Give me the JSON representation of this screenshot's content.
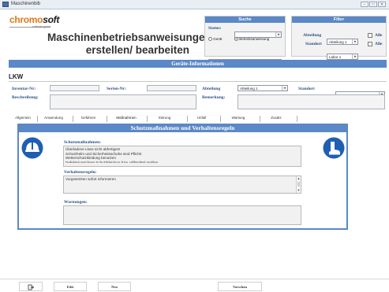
{
  "window": {
    "title": "Maschinenbib",
    "min": "–",
    "max": "□",
    "close": "✕"
  },
  "logo": {
    "part1": "chromo",
    "part2": "soft",
    "tagline": "software gmbh"
  },
  "main_title": {
    "line1": "Maschinenbetriebsanweisungen",
    "line2": "erstellen/ bearbeiten"
  },
  "suche": {
    "header": "Suche",
    "status_label": "Status:",
    "status_value": "",
    "radio_geraet": "Gerät",
    "radio_betrieb": "Betriebsanweisung",
    "selected_radio": "Betriebsanweisung",
    "search_value": ""
  },
  "filter": {
    "header": "Filter",
    "abteilung_label": "Abteilung",
    "abteilung_value": "Abteilung 1",
    "standort_label": "Standort",
    "standort_value": "Labor 1",
    "alle1": "Alle",
    "alle2": "Alle"
  },
  "geraete": {
    "header": "Geräte-Informationen",
    "device_name": "LKW",
    "inventar_label": "Inventar-Nr:",
    "inventar_value": "",
    "serien_label": "Serien-Nr:",
    "serien_value": "",
    "abteilung_label": "Abteilung",
    "abteilung_value": "Abteilung 1",
    "standort_label": "Standort",
    "standort_value": "",
    "beschreibung_label": "Beschreibung:",
    "beschreibung_value": "",
    "bemerkung_label": "Bemerkung:",
    "bemerkung_value": ""
  },
  "tabs": [
    "Allgemein",
    "Anwendung",
    "Gefahren",
    "Maßnahmen",
    "Störung",
    "Unfall",
    "Wartung",
    "Zusätz"
  ],
  "active_tab": "Maßnahmen",
  "section": {
    "title": "Schutzmaßnahmen und Verhaltensregeln",
    "schutz_label": "Schutzmaßnahmen:",
    "schutz_lines": [
      "Überladene Lkws nicht abfertigen!",
      "Schutzhelm und Sicherheitsschuhe sind Pflicht!",
      "Wetterschutzkleidung benutzen",
      "Defekte/unsichere Schutzkleidung bzw. Hilfsmittel melden"
    ],
    "verhalten_label": "Verhaltensregeln:",
    "verhalten_lines": [
      "Vorgesetzten sofort informieren"
    ],
    "warnungen_label": "Warnungen:",
    "warnungen_value": ""
  },
  "footer": {
    "exit_icon": "exit-icon",
    "edit": "Edit",
    "neu": "Neu",
    "vorschau": "Vorschau"
  },
  "colors": {
    "accent": "#5b88c6",
    "label": "#2c4f86",
    "logo_orange": "#e07a1a"
  }
}
